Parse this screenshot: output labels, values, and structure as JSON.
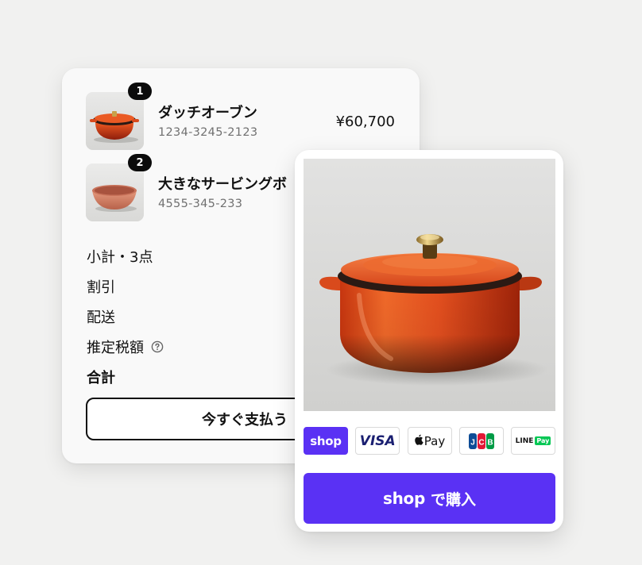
{
  "cart": {
    "items": [
      {
        "quantity": "1",
        "name": "ダッチオーブン",
        "sku": "1234-3245-2123",
        "price": "¥60,700",
        "image_icon": "dutch-oven"
      },
      {
        "quantity": "2",
        "name": "大きなサービングボ",
        "sku": "4555-345-233",
        "image_icon": "serving-bowl"
      }
    ],
    "summary": {
      "subtotal_label": "小計・3点",
      "discount_label": "割引",
      "shipping_label": "配送",
      "tax_label": "推定税額",
      "total_label": "合計"
    },
    "pay_now_label": "今すぐ支払う"
  },
  "product_card": {
    "image_icon": "dutch-oven-photo",
    "payment_methods": [
      "shop",
      "VISA",
      "Pay",
      "JCB",
      "LINE",
      "Pay"
    ],
    "buy_button": {
      "logo": "shop",
      "label": "で購入"
    }
  },
  "colors": {
    "background": "#f1f1f0",
    "shop_purple": "#5a31f4",
    "badge_dark": "#0b0b0b",
    "pot_orange": "#e5501f",
    "line_green": "#06c755",
    "visa_blue": "#1a1f71"
  }
}
